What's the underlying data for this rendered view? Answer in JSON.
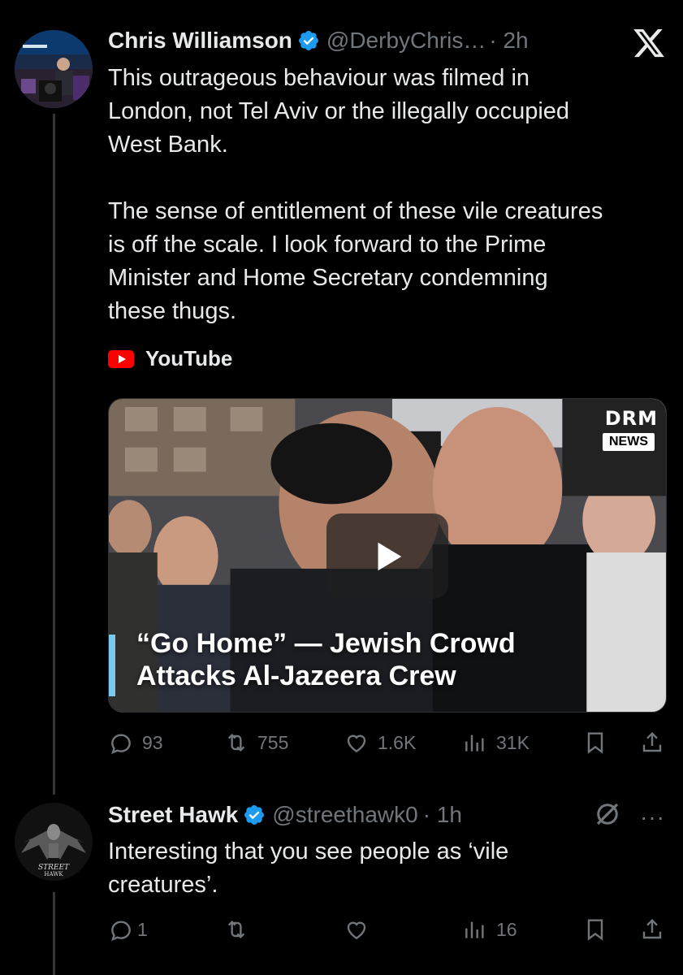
{
  "tweet1": {
    "name": "Chris Williamson",
    "handle": "@DerbyChris…",
    "time": "· 2h",
    "text": "This outrageous behaviour was filmed in\nLondon, not Tel Aviv or the illegally occupied\nWest Bank.\n\nThe sense of entitlement of these vile creatures\nis off the scale. I look forward to the Prime\nMinister and Home Secretary condemning\nthese thugs.",
    "source_label": "YouTube",
    "video": {
      "caption_line1": "“Go Home” — Jewish Crowd",
      "caption_line2": "Attacks Al-Jazeera Crew",
      "logo": "DRM",
      "badge": "NEWS"
    },
    "actions": {
      "replies": "93",
      "reposts": "755",
      "likes": "1.6K",
      "views": "31K"
    }
  },
  "tweet2": {
    "name": "Street Hawk",
    "handle": "@streethawk0",
    "time": "· 1h",
    "text": "Interesting that you see people as ‘vile\ncreatures’.",
    "avatar_text_1": "STREET",
    "avatar_text_2": "HAWK",
    "actions": {
      "replies": "1",
      "reposts": "",
      "likes": "",
      "views": "16"
    }
  },
  "more_label": "···",
  "colors": {
    "background": "#000000",
    "text": "#e7e9ea",
    "muted": "#71767b",
    "verified": "#1d9bf0",
    "youtube": "#ff0000",
    "caption_bar": "#7cc8ef"
  },
  "icons": [
    "x-logo-icon",
    "verified-icon",
    "youtube-icon",
    "play-icon",
    "reply-icon",
    "repost-icon",
    "like-icon",
    "views-icon",
    "bookmark-icon",
    "share-icon",
    "grok-icon",
    "more-icon"
  ]
}
